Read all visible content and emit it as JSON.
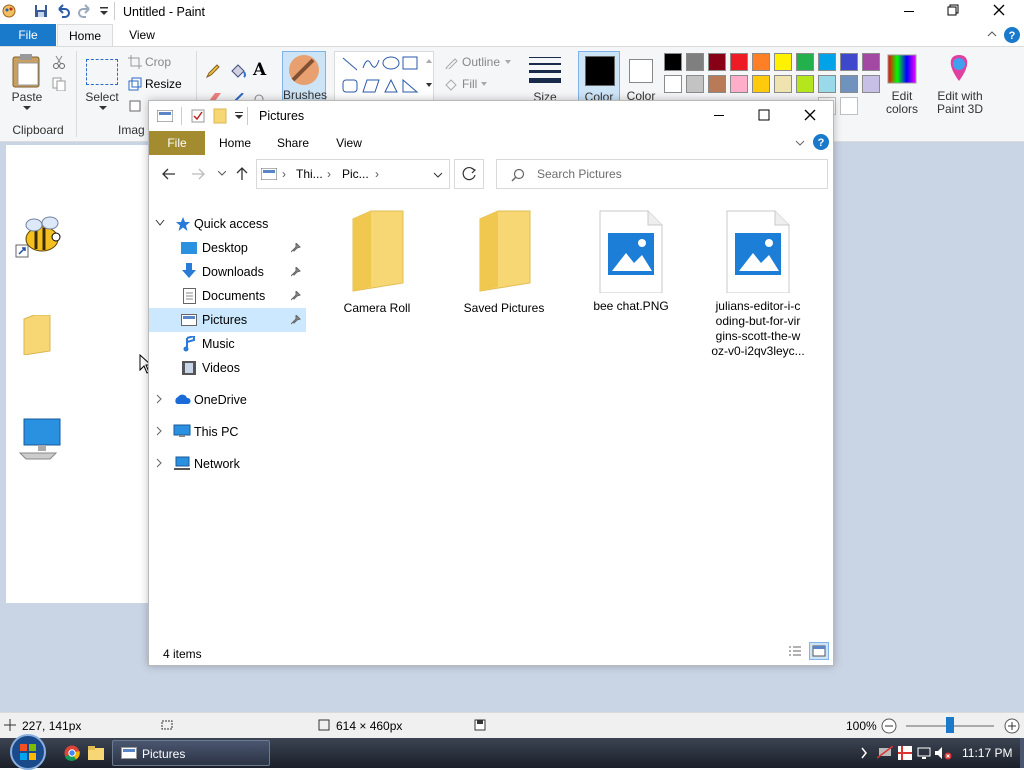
{
  "paint": {
    "window_title": "Untitled - Paint",
    "tabs": [
      "File",
      "Home",
      "View"
    ],
    "ribbon": {
      "paste": "Paste",
      "clipboard_group": "Clipboard",
      "select": "Select",
      "image_group_partial": "Imag",
      "crop": "Crop",
      "resize": "Resize",
      "brushes": "Brushes",
      "outline": "Outline",
      "fill": "Fill",
      "size": "Size",
      "color1": "Color",
      "color2": "Color",
      "edit_colors": "Edit colors",
      "edit_with_paint3d": "Edit with Paint 3D"
    },
    "palette_row1": [
      "#000000",
      "#7f7f7f",
      "#880015",
      "#ed1c24",
      "#ff7f27",
      "#fff200",
      "#22b14c",
      "#00a2e8",
      "#3f48cc",
      "#a349a4"
    ],
    "palette_row2": [
      "#ffffff",
      "#c3c3c3",
      "#b97a57",
      "#ffaec9",
      "#ffc90e",
      "#efe4b0",
      "#b5e61d",
      "#99d9ea",
      "#7092be",
      "#c8bfe7"
    ],
    "status": {
      "cursor_pos": "227, 141px",
      "canvas_size": "614 × 460px",
      "zoom": "100%"
    }
  },
  "explorer": {
    "title": "Pictures",
    "tabs": [
      "File",
      "Home",
      "Share",
      "View"
    ],
    "breadcrumb": [
      "Thi...",
      "Pic..."
    ],
    "search_placeholder": "Search Pictures",
    "nav": {
      "quick_access": "Quick access",
      "desktop": "Desktop",
      "downloads": "Downloads",
      "documents": "Documents",
      "pictures": "Pictures",
      "music": "Music",
      "videos": "Videos",
      "onedrive": "OneDrive",
      "this_pc": "This PC",
      "network": "Network"
    },
    "items": [
      {
        "name": "Camera Roll",
        "type": "folder-icon"
      },
      {
        "name": "Saved Pictures",
        "type": "folder-icon"
      },
      {
        "name": "bee chat.PNG",
        "type": "image-file-icon"
      },
      {
        "name": "julians-editor-i-coding-but-for-virgins-scott-the-woz-v0-i2qv3leyc...",
        "type": "image-file-icon",
        "lines": [
          "julians-editor-i-c",
          "oding-but-for-vir",
          "gins-scott-the-w",
          "oz-v0-i2qv3leyc..."
        ]
      }
    ],
    "status_count": "4 items"
  },
  "taskbar": {
    "active_window": "Pictures",
    "clock": "11:17 PM"
  },
  "colors": {
    "accent_blue": "#0078d7",
    "file_tab_gold": "#a28c2f",
    "canvas_bg": "#c9d4e5"
  }
}
